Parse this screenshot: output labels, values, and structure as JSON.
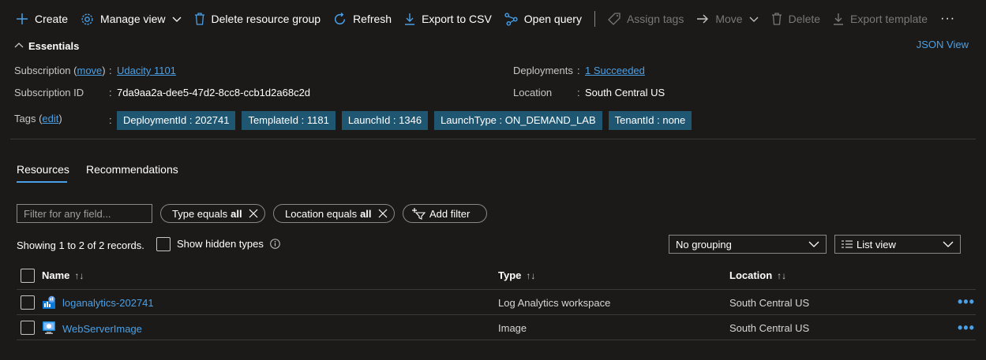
{
  "toolbar": {
    "create": "Create",
    "manage_view": "Manage view",
    "delete_rg": "Delete resource group",
    "refresh": "Refresh",
    "export_csv": "Export to CSV",
    "open_query": "Open query",
    "assign_tags": "Assign tags",
    "move": "Move",
    "delete": "Delete",
    "export_template": "Export template",
    "more": "···"
  },
  "essentials": {
    "title": "Essentials",
    "json_view": "JSON View",
    "subscription_label": "Subscription (",
    "subscription_move": "move",
    "subscription_label_end": ")",
    "subscription_value": "Udacity 1101",
    "subscription_id_label": "Subscription ID",
    "subscription_id_value": "7da9aa2a-dee5-47d2-8cc8-ccb1d2a68c2d",
    "tags_label": "Tags (",
    "tags_edit": "edit",
    "tags_label_end": ")",
    "deployments_label": "Deployments",
    "deployments_value": "1 Succeeded",
    "location_label": "Location",
    "location_value": "South Central US",
    "colon": ":",
    "tags": [
      "DeploymentId : 202741",
      "TemplateId : 1181",
      "LaunchId : 1346",
      "LaunchType : ON_DEMAND_LAB",
      "TenantId : none"
    ]
  },
  "tabs": [
    "Resources",
    "Recommendations"
  ],
  "filters": {
    "placeholder": "Filter for any field...",
    "type_label": "Type equals",
    "type_value": "all",
    "location_label": "Location equals",
    "location_value": "all",
    "add_filter": "Add filter"
  },
  "records": {
    "showing": "Showing 1 to 2 of 2 records.",
    "show_hidden": "Show hidden types",
    "grouping": "No grouping",
    "view": "List view"
  },
  "table": {
    "columns": [
      "Name",
      "Type",
      "Location"
    ],
    "sort_glyph": "↑↓",
    "rows": [
      {
        "name": "loganalytics-202741",
        "type": "Log Analytics workspace",
        "location": "South Central US",
        "icon": "log-analytics-icon"
      },
      {
        "name": "WebServerImage",
        "type": "Image",
        "location": "South Central US",
        "icon": "vm-image-icon"
      }
    ],
    "row_more": "•••"
  },
  "colors": {
    "accent": "#4aa0e6",
    "tag_bg": "#1f5773",
    "background": "#1b1a19"
  }
}
